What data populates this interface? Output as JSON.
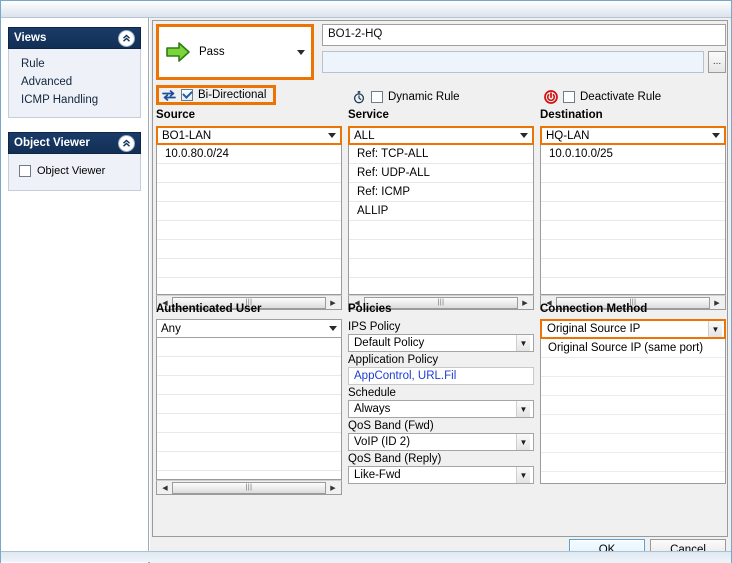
{
  "sidebar": {
    "views_panel": {
      "title": "Views",
      "collapse_icon": "chevron-up-icon",
      "items": [
        {
          "label": "Rule"
        },
        {
          "label": "Advanced"
        },
        {
          "label": "ICMP Handling"
        }
      ]
    },
    "object_viewer_panel": {
      "title": "Object Viewer",
      "collapse_icon": "chevron-up-icon",
      "checkbox_label": "Object Viewer",
      "checked": false
    }
  },
  "action": {
    "icon": "green-right-arrow-icon",
    "value": "Pass",
    "highlight_color": "#ec7404"
  },
  "rule_name": {
    "value": "BO1-2-HQ"
  },
  "comment": {
    "value": "",
    "browse_button_label": "..."
  },
  "flags": [
    {
      "name": "bi-directional",
      "icon": "bi-directional-arrows-icon",
      "label": "Bi-Directional",
      "checked": true,
      "highlighted": true
    },
    {
      "name": "dynamic-rule",
      "icon": "stopwatch-icon",
      "label": "Dynamic Rule",
      "checked": false,
      "highlighted": false
    },
    {
      "name": "deactivate-rule",
      "icon": "power-icon",
      "label": "Deactivate Rule",
      "checked": false,
      "highlighted": false
    }
  ],
  "columns": {
    "source": {
      "title": "Source",
      "selected": "BO1-LAN",
      "items": [
        "10.0.80.0/24"
      ]
    },
    "service": {
      "title": "Service",
      "selected": "ALL",
      "items": [
        "Ref: TCP-ALL",
        "Ref: UDP-ALL",
        "Ref: ICMP",
        "ALLIP"
      ]
    },
    "destination": {
      "title": "Destination",
      "selected": "HQ-LAN",
      "items": [
        "10.0.10.0/25"
      ]
    }
  },
  "authenticated_user": {
    "title": "Authenticated User",
    "selected": "Any",
    "items": []
  },
  "policies": {
    "title": "Policies",
    "ips_policy_label": "IPS Policy",
    "ips_policy_value": "Default Policy",
    "application_policy_label": "Application Policy",
    "application_policy_value": "AppControl, URL.Fil",
    "schedule_label": "Schedule",
    "schedule_value": "Always",
    "qos_fwd_label": "QoS Band (Fwd)",
    "qos_fwd_value": "VoIP (ID 2)",
    "qos_reply_label": "QoS Band (Reply)",
    "qos_reply_value": "Like-Fwd"
  },
  "connection_method": {
    "title": "Connection Method",
    "selected": "Original Source IP",
    "options": [
      "Original Source IP (same port)"
    ]
  },
  "footer": {
    "ok_label": "OK",
    "cancel_label": "Cancel"
  }
}
